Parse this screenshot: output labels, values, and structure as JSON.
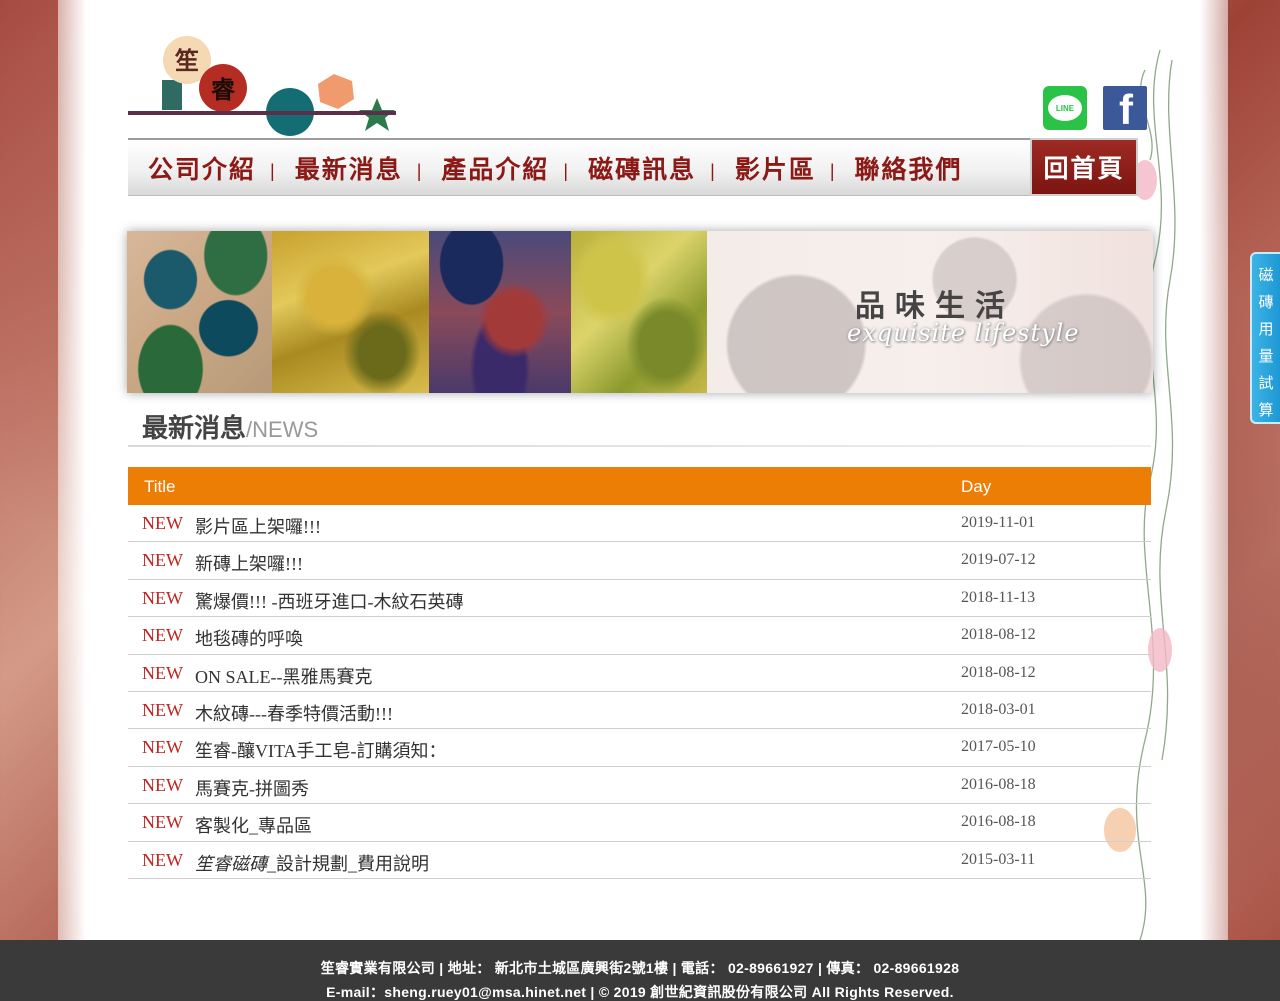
{
  "logo": {
    "char_top": "笙",
    "char_bottom": "睿"
  },
  "social": {
    "line_label": "LINE",
    "facebook_label": "f"
  },
  "nav": {
    "items": [
      "公司介紹",
      "最新消息",
      "產品介紹",
      "磁磚訊息",
      "影片區",
      "聯絡我們"
    ],
    "separator": "|",
    "home_label": "回首頁"
  },
  "banner": {
    "title": "品味生活",
    "subtitle": "exquisite lifestyle"
  },
  "news": {
    "heading": "最新消息",
    "heading_en": "/NEWS",
    "col_title": "Title",
    "col_day": "Day",
    "rows": [
      {
        "tag": "NEW",
        "title": "影片區上架囉!!!",
        "date": "2019-11-01",
        "italic": false
      },
      {
        "tag": "NEW",
        "title": "新磚上架囉!!!",
        "date": "2019-07-12",
        "italic": false
      },
      {
        "tag": "NEW",
        "title": "驚爆價!!! -西班牙進口-木紋石英磚",
        "date": "2018-11-13",
        "italic": false
      },
      {
        "tag": "NEW",
        "title": "地毯磚的呼喚",
        "date": "2018-08-12",
        "italic": false
      },
      {
        "tag": "NEW",
        "title": "ON SALE--黑雅馬賽克",
        "date": "2018-08-12",
        "italic": false
      },
      {
        "tag": "NEW",
        "title": "木紋磚---春季特價活動!!!",
        "date": "2018-03-01",
        "italic": false
      },
      {
        "tag": "NEW",
        "title": "笙睿-釀VITA手工皂-訂購須知：",
        "date": "2017-05-10",
        "italic": false
      },
      {
        "tag": "NEW",
        "title": "馬賽克-拼圖秀",
        "date": "2016-08-18",
        "italic": false
      },
      {
        "tag": "NEW",
        "title": "客製化_專品區",
        "date": "2016-08-18",
        "italic": false
      },
      {
        "tag": "NEW",
        "title_italic": "笙睿磁磚",
        "title_rest": "_設計規劃_費用說明",
        "date": "2015-03-11",
        "italic": true
      }
    ]
  },
  "side_tab": {
    "chars": [
      "磁",
      "磚",
      "用",
      "量",
      "試",
      "算"
    ]
  },
  "footer": {
    "line1": "笙睿實業有限公司 | 地址： 新北市土城區廣興街2號1樓 | 電話： 02-89661927 | 傳真： 02-89661928",
    "line2": "E-mail：sheng.ruey01@msa.hinet.net | © 2019 創世紀資訊股份有限公司 All Rights Reserved."
  },
  "colors": {
    "brand_red": "#8b1a16",
    "accent_orange": "#ec7d05",
    "new_tag": "#c0221e",
    "side_tab_blue": "#1e98d4",
    "footer_bg": "#3a3a3a"
  }
}
